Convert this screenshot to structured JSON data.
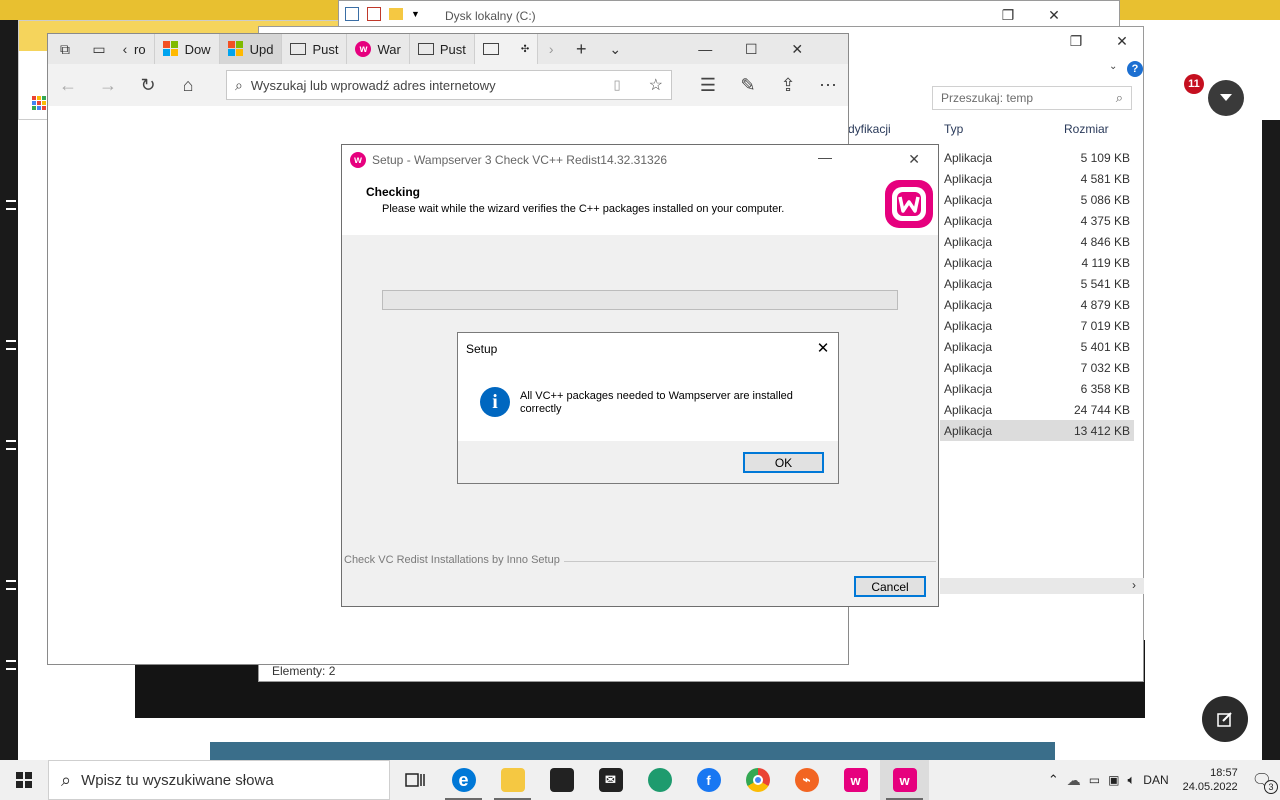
{
  "explorer_back": {
    "title": "Dysk lokalny (C:)"
  },
  "explorer": {
    "search_placeholder": "Przeszukaj: temp",
    "columns": {
      "modified": "dyfikacji",
      "type": "Typ",
      "size": "Rozmiar"
    },
    "rows": [
      {
        "type": "Aplikacja",
        "size": "5 109 KB"
      },
      {
        "type": "Aplikacja",
        "size": "4 581 KB"
      },
      {
        "type": "Aplikacja",
        "size": "5 086 KB"
      },
      {
        "type": "Aplikacja",
        "size": "4 375 KB"
      },
      {
        "type": "Aplikacja",
        "size": "4 846 KB"
      },
      {
        "type": "Aplikacja",
        "size": "4 119 KB"
      },
      {
        "type": "Aplikacja",
        "size": "5 541 KB"
      },
      {
        "type": "Aplikacja",
        "size": "4 879 KB"
      },
      {
        "type": "Aplikacja",
        "size": "7 019 KB"
      },
      {
        "type": "Aplikacja",
        "size": "5 401 KB"
      },
      {
        "type": "Aplikacja",
        "size": "7 032 KB"
      },
      {
        "type": "Aplikacja",
        "size": "6 358 KB"
      },
      {
        "type": "Aplikacja",
        "size": "24 744 KB"
      },
      {
        "type": "Aplikacja",
        "size": "13 412 KB"
      }
    ],
    "status": "Elementy: 2"
  },
  "bg_badge": "11",
  "edge": {
    "tabs": [
      {
        "label": "ro"
      },
      {
        "label": "Dow"
      },
      {
        "label": "Upd"
      },
      {
        "label": "Pust"
      },
      {
        "label": "War"
      },
      {
        "label": "Pust"
      }
    ],
    "address_placeholder": "Wyszukaj lub wprowadź adres internetowy"
  },
  "wizard": {
    "title": "Setup - Wampserver 3 Check VC++ Redist14.32.31326",
    "heading": "Checking",
    "subheading": "Please wait while the wizard verifies the C++ packages installed on your computer.",
    "footer_brand": "Check VC Redist Installations by Inno Setup",
    "cancel_label": "Cancel",
    "progress": 0.0
  },
  "msgbox": {
    "title": "Setup",
    "message": "All VC++ packages needed to Wampserver are installed correctly",
    "ok_label": "OK"
  },
  "taskbar": {
    "search_placeholder": "Wpisz tu wyszukiwane słowa",
    "lang": "DAN",
    "time": "18:57",
    "date": "24.05.2022",
    "notifications": "3"
  },
  "colors": {
    "accent": "#0078d7",
    "wamp": "#e6007e",
    "taskbar": "#f0f0f0"
  }
}
